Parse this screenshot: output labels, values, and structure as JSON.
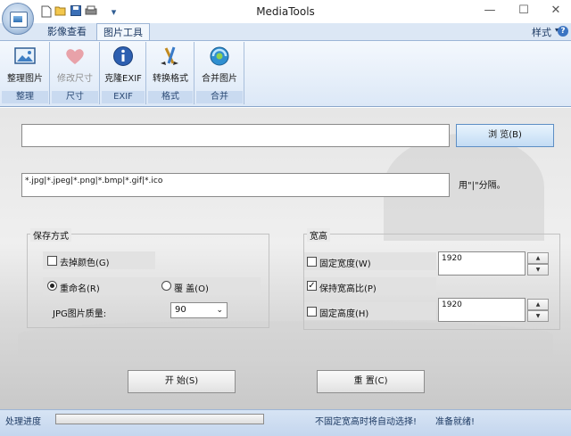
{
  "window": {
    "title": "MediaTools",
    "minimize": "—",
    "maximize": "☐",
    "close": "✕"
  },
  "qat": {
    "new_icon": "new-document-icon",
    "open_icon": "open-folder-icon",
    "save_icon": "save-icon",
    "print_icon": "print-icon",
    "customize": "▾"
  },
  "ribbon": {
    "tabs": [
      {
        "label": "影像查看"
      },
      {
        "label": "图片工具"
      }
    ],
    "style_label": "样式",
    "style_arrow": "▾",
    "help": "?",
    "groups": [
      {
        "label": "整理"
      },
      {
        "label": "尺寸"
      },
      {
        "label": "EXIF"
      },
      {
        "label": "格式"
      },
      {
        "label": "合并"
      }
    ],
    "buttons": [
      {
        "label": "整理图片",
        "icon": "picture-icon"
      },
      {
        "label": "修改尺寸",
        "icon": "heart-icon"
      },
      {
        "label": "克隆EXIF",
        "icon": "info-icon"
      },
      {
        "label": "转换格式",
        "icon": "convert-icon"
      },
      {
        "label": "合并图片",
        "icon": "merge-icon"
      }
    ]
  },
  "main": {
    "path_value": "",
    "browse_label": "浏 览(B)",
    "filter_value": "*.jpg|*.jpeg|*.png|*.bmp|*.gif|*.ico",
    "filter_hint": "用\"|\"分隔。",
    "save_mode": {
      "legend": "保存方式",
      "remove_color_label": "去掉颜色(G)",
      "rename_label": "重命名(R)",
      "overwrite_label": "覆 盖(O)",
      "quality_label": "JPG图片质量:",
      "quality_value": "90"
    },
    "size": {
      "legend": "宽高",
      "fixed_width_label": "固定宽度(W)",
      "width_value": "1920",
      "keep_ratio_label": "保持宽高比(P)",
      "fixed_height_label": "固定高度(H)",
      "height_value": "1920"
    },
    "start_label": "开 始(S)",
    "reset_label": "重 置(C)"
  },
  "status": {
    "progress_label": "处理进度",
    "progress": 0,
    "hint": "不固定宽高时将自动选择!",
    "ready": "准备就绪!"
  }
}
